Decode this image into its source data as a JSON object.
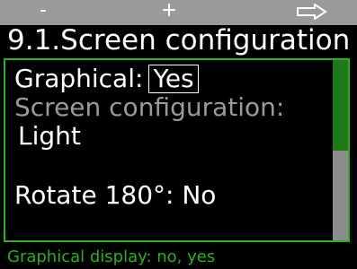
{
  "softkeys": {
    "minus_label": "-",
    "plus_label": "+",
    "next_icon": "arrow-right-icon"
  },
  "title": "9.1.Screen configuration",
  "settings": {
    "graphical_label": "Graphical:",
    "graphical_value": "Yes",
    "screen_config_label": "Screen configuration:",
    "screen_config_value": "Light",
    "rotate_label": "Rotate 180°:",
    "rotate_value": "No"
  },
  "scroll_position_fraction": 0.5,
  "help_text": "Graphical display: no, yes",
  "colors": {
    "accent_green": "#2bb01e",
    "muted_gray": "#9a9a9a",
    "scroll_thumb": "#1e7a18"
  }
}
